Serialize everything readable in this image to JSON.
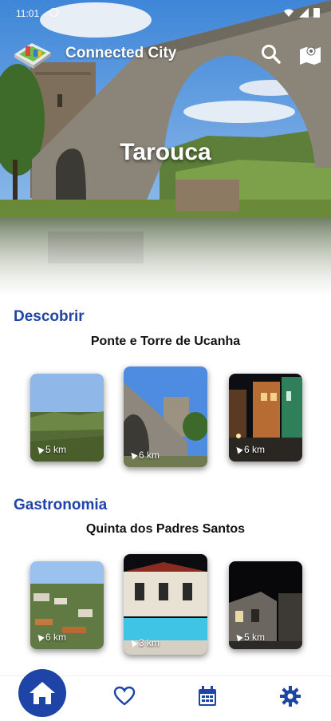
{
  "status": {
    "time": "11:01"
  },
  "app": {
    "title": "Connected City"
  },
  "hero": {
    "city": "Tarouca"
  },
  "sections": [
    {
      "title": "Descobrir",
      "subtitle": "Ponte e Torre de Ucanha",
      "cards": [
        {
          "distance": "5 km",
          "image": "landscape-valley"
        },
        {
          "distance": "6 km",
          "image": "stone-bridge-tower"
        },
        {
          "distance": "6 km",
          "image": "night-street"
        }
      ]
    },
    {
      "title": "Gastronomia",
      "subtitle": "Quinta dos Padres Santos",
      "cards": [
        {
          "distance": "6 km",
          "image": "countryside-houses"
        },
        {
          "distance": "3 km",
          "image": "pool-night"
        },
        {
          "distance": "5 km",
          "image": "stone-house-night"
        }
      ]
    }
  ],
  "nav": {
    "items": [
      "home-icon",
      "heart-icon",
      "calendar-icon",
      "gear-icon"
    ],
    "accent": "#1d44a6"
  }
}
